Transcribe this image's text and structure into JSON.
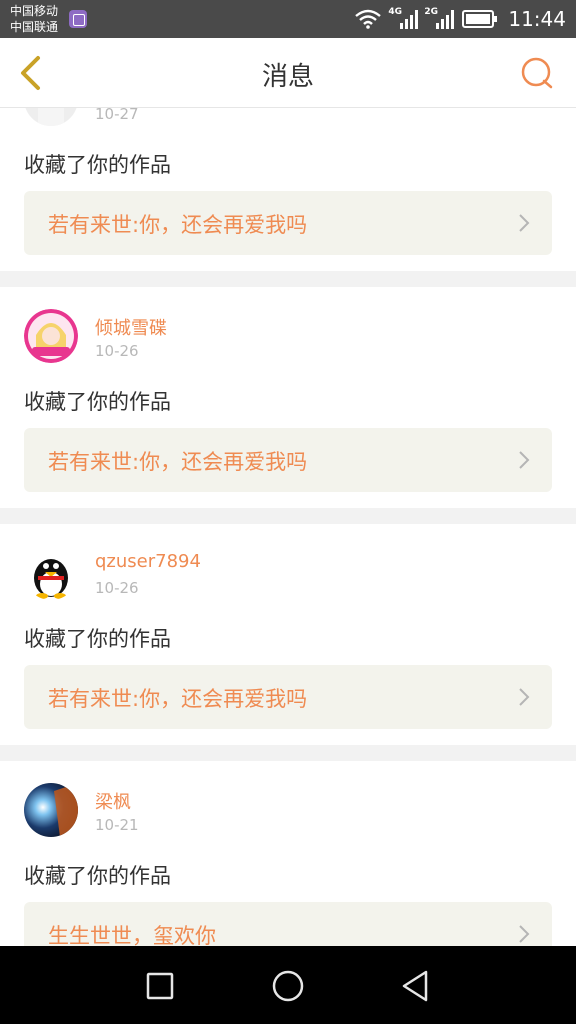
{
  "status_bar": {
    "carrier_1": "中国移动",
    "carrier_2": "中国联通",
    "network_1": "4G",
    "network_2": "2G",
    "time": "11:44"
  },
  "header": {
    "title": "消息",
    "back_icon": "chevron-left-icon",
    "right_icon": "chat-bubble-icon"
  },
  "colors": {
    "accent": "#ef8b52",
    "back_icon": "#c9a227",
    "work_box_bg": "#f3f3ec"
  },
  "messages": [
    {
      "username": "",
      "date": "10-27",
      "action": "收藏了你的作品",
      "work_title": "若有来世:你，还会再爱我吗"
    },
    {
      "username": "倾城雪碟",
      "date": "10-26",
      "action": "收藏了你的作品",
      "work_title": "若有来世:你，还会再爱我吗"
    },
    {
      "username": "qzuser7894",
      "date": "10-26",
      "action": "收藏了你的作品",
      "work_title": "若有来世:你，还会再爱我吗"
    },
    {
      "username": "梁枫",
      "date": "10-21",
      "action": "收藏了你的作品",
      "work_title": "生生世世，玺欢你"
    }
  ],
  "nav_bar": {
    "recent_icon": "square-icon",
    "home_icon": "circle-icon",
    "back_icon": "triangle-back-icon"
  }
}
